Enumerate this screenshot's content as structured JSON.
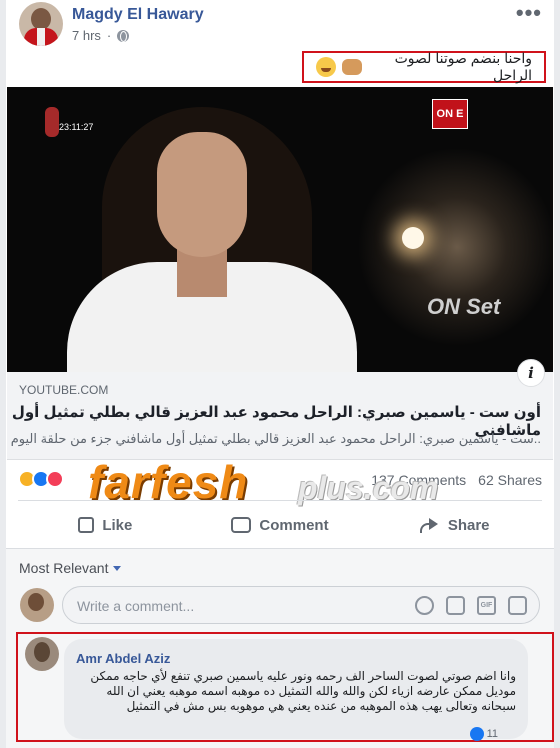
{
  "post": {
    "author": "Magdy El Hawary",
    "time": "7 hrs",
    "more_label": "•••",
    "text": "واحنا بنضم صوتنا لصوت الراحل"
  },
  "video": {
    "channel_badge": "ON E",
    "timecode": "23:11:27",
    "watermark": "ON Set",
    "info_label": "i"
  },
  "link": {
    "domain": "YOUTUBE.COM",
    "title": "أون ست - ياسمين صبري: الراحل محمود عبد العزيز قالي بطلي تمثيل أول ماشافني",
    "description": "..ست - ياسمين صبري: الراحل محمود عبد العزيز قالي بطلي تمثيل أول ماشافني جزء من حلقة اليوم"
  },
  "stats": {
    "comments": "137 Comments",
    "shares": "62 Shares"
  },
  "watermark": {
    "main": "farfesh",
    "plus": "plus.com"
  },
  "actions": {
    "like": "Like",
    "comment": "Comment",
    "share": "Share"
  },
  "comments": {
    "sort_label": "Most Relevant",
    "input_placeholder": "Write a comment...",
    "top_comment": {
      "author": "Amr Abdel Aziz",
      "text": "وانا اضم صوتي لصوت الساحر الف رحمه ونور عليه ياسمين صبري تنفع لأي حاجه ممكن موديل ممكن عارضه ازياء لكن والله والله التمثيل ده موهبه اسمه موهبه يعني ان الله سبحانه وتعالى يهب هذه الموهبه من عنده يعني هي موهوبه بس مش في التمثيل",
      "reactions": "11"
    }
  },
  "icons": {
    "globe": "globe-icon",
    "more": "more-options-icon",
    "info": "info-icon",
    "like": "thumbs-up-icon",
    "comment": "comment-bubble-icon",
    "share": "share-arrow-icon",
    "emoji": "emoji-icon",
    "camera": "camera-icon",
    "gif": "gif-icon",
    "sticker": "sticker-icon"
  },
  "colors": {
    "link_blue": "#385898",
    "highlight_red": "#d0121b",
    "like_blue": "#1877f2",
    "love_red": "#f33e58",
    "haha_yellow": "#f7b125"
  }
}
